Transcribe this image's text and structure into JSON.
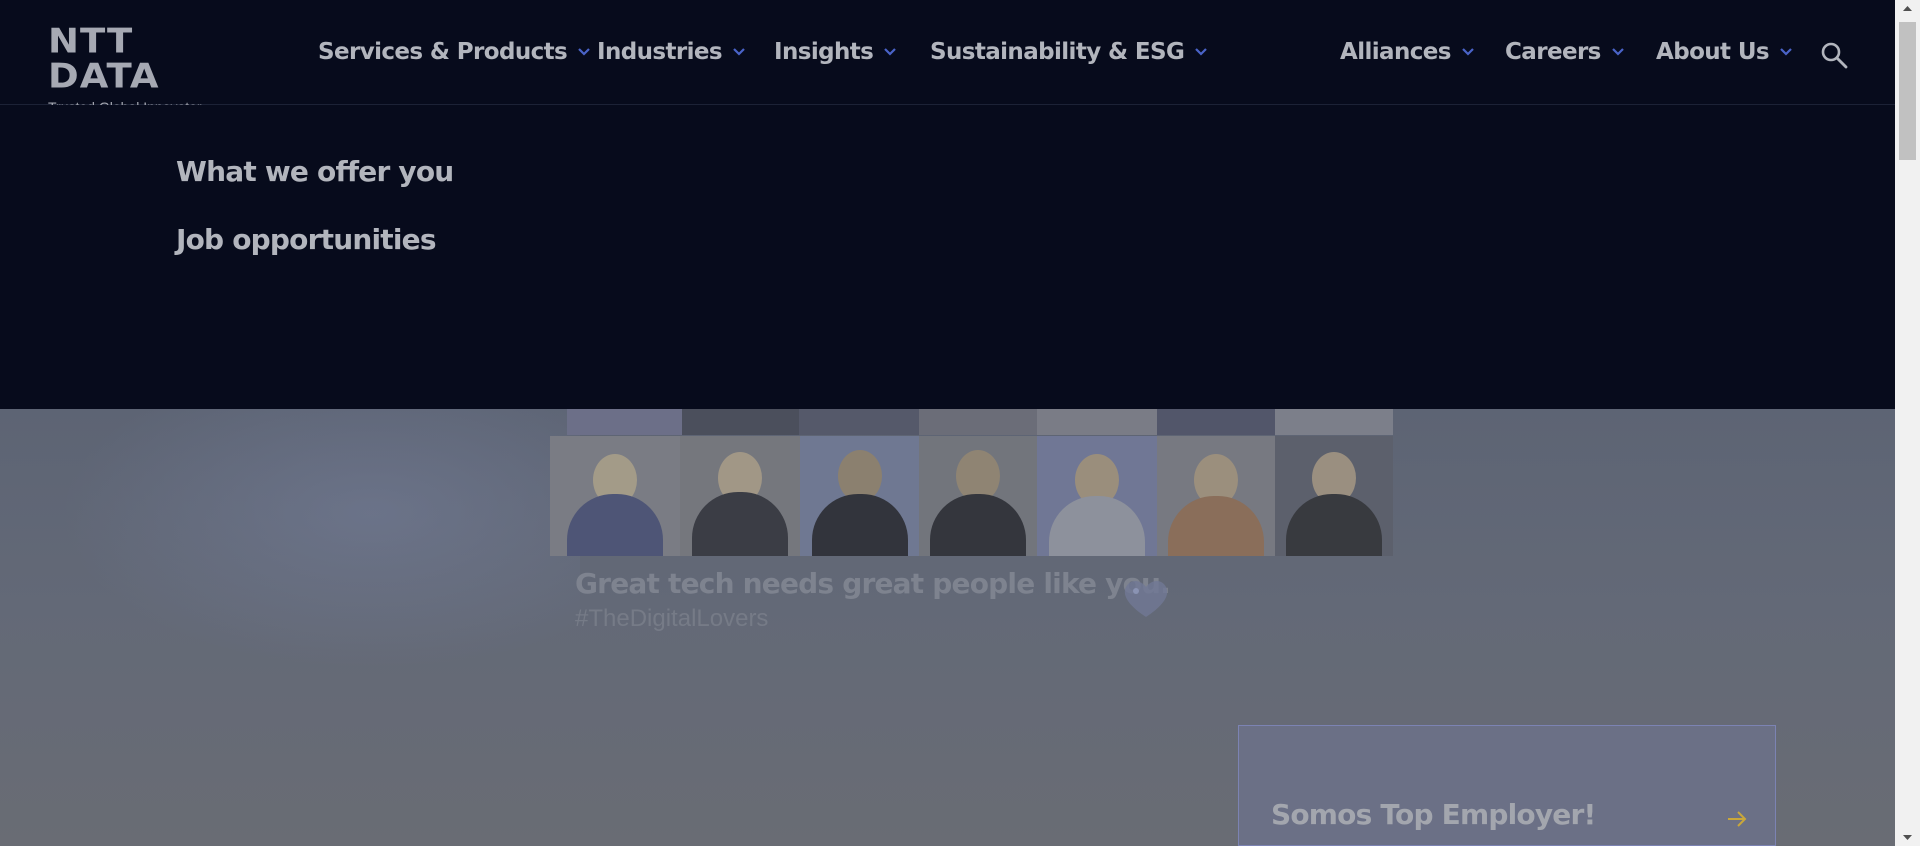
{
  "logo": {
    "main": "NTT DATA",
    "tagline": "Trusted Global Innovator"
  },
  "nav": {
    "items": [
      {
        "label": "Services & Products"
      },
      {
        "label": "Industries"
      },
      {
        "label": "Insights"
      },
      {
        "label": "Sustainability & ESG"
      },
      {
        "label": "Alliances"
      },
      {
        "label": "Careers"
      },
      {
        "label": "About Us"
      }
    ],
    "search_icon": "search-icon",
    "chevron_icon": "chevron-down-icon"
  },
  "mega_menu": {
    "links": [
      {
        "label": "What we offer you"
      },
      {
        "label": "Job opportunities"
      }
    ]
  },
  "hero": {
    "headline": "Great tech needs great people like you.",
    "hashtag": "#TheDigitalLovers",
    "heart_icon": "heart-icon"
  },
  "promo": {
    "title": "Somos Top Employer!",
    "arrow_icon": "arrow-right-icon"
  },
  "colors": {
    "nav_bg": "#070b1c",
    "nav_text": "#b2b5bd",
    "chevron": "#4a63c8",
    "overlay": "#6a6f7a",
    "promo_arrow": "#c9a73a"
  }
}
